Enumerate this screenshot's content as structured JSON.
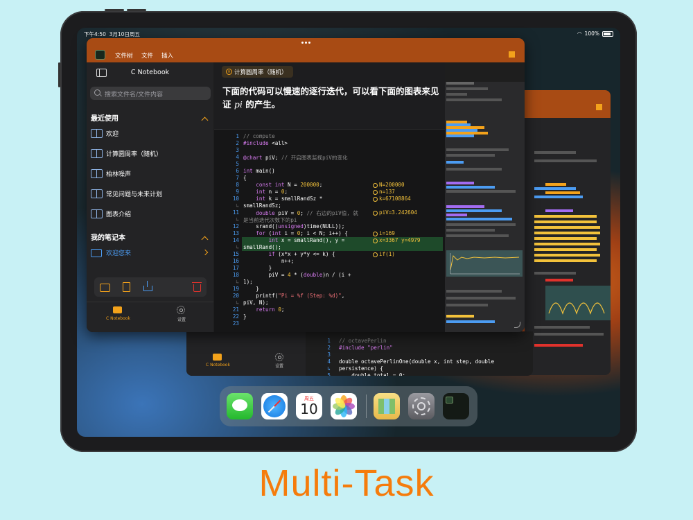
{
  "status": {
    "time": "下午4:50",
    "date": "3月10日周五",
    "battery": "100%"
  },
  "menu": {
    "items": [
      "文件树",
      "文件",
      "插入"
    ]
  },
  "sidebar": {
    "title": "C Notebook",
    "search_placeholder": "搜索文件名/文件内容",
    "recent_header": "最近使用",
    "recent": [
      "欢迎",
      "计算圆周率（随机）",
      "柏林噪声",
      "常见问题与未来计划",
      "图表介绍"
    ],
    "notebooks_header": "我的笔记本",
    "notebooks": [
      "欢迎您来"
    ],
    "tab_notebook": "C Notebook",
    "tab_settings": "设置"
  },
  "doc": {
    "tab_title": "计算圆周率（随机）",
    "paragraph_a": "下面的代码可以慢速的逐行迭代，可以看下面的图表来见证 ",
    "paragraph_pi": "pi",
    "paragraph_b": " 的产生。"
  },
  "code": {
    "line_numbers": [
      "1",
      "2",
      "3",
      "4",
      "5",
      "6",
      "7",
      "8",
      "9",
      "10",
      "",
      "11",
      "",
      "12",
      "13",
      "14",
      "",
      "15",
      "16",
      "17",
      "18",
      "",
      "19",
      "20",
      "",
      "21",
      "22",
      "23"
    ],
    "annotations": {
      "a8": "N=200000",
      "a9": "n=137",
      "a10": "k=67108864",
      "a11": "piV=3.242604",
      "a13": "i=169",
      "a14": "x=3367 y=4979",
      "a15": "if(1)"
    }
  },
  "back_window": {
    "code_line_numbers": [
      "1",
      "2",
      "3",
      "4",
      "",
      "5"
    ],
    "code_lines": [
      "// octavePerlin",
      "#include \"perlin\"",
      "",
      "double octavePerlinOne(double x, int step, double",
      "persistence) {",
      "    double total = 0;"
    ],
    "tab_notebook": "C Notebook",
    "tab_settings": "设置"
  },
  "dock": {
    "calendar_weekday": "周五",
    "calendar_day": "10"
  },
  "headline": "Multi-Task",
  "colors": {
    "accent": "#f3a21b",
    "titlebar": "#a84b14",
    "link": "#4c9cf2",
    "headline": "#f57c0c"
  }
}
